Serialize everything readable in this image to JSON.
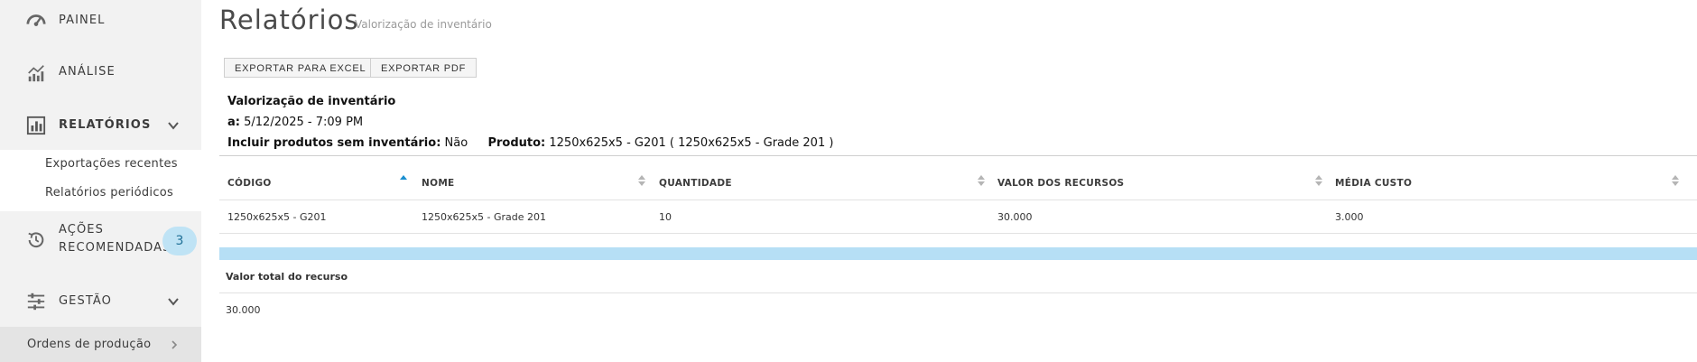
{
  "sidebar": {
    "items": [
      {
        "label": "PAINEL",
        "icon": "gauge-icon"
      },
      {
        "label": "ANÁLISE",
        "icon": "analytics-icon"
      },
      {
        "label": "RELATÓRIOS",
        "icon": "reports-icon"
      },
      {
        "label": "AÇÕES",
        "label2": "RECOMENDADAS",
        "icon": "history-icon",
        "badge": "3"
      },
      {
        "label": "GESTÃO",
        "icon": "sliders-icon"
      }
    ],
    "subitems": [
      "Exportações recentes",
      "Relatórios periódicos"
    ],
    "bottom": {
      "label": "Ordens de produção"
    }
  },
  "header": {
    "title": "Relatórios",
    "subtitle": "Valorização de inventário"
  },
  "toolbar": {
    "excel_label": "EXPORTAR PARA EXCEL",
    "pdf_label": "EXPORTAR PDF"
  },
  "report": {
    "title": "Valorização de inventário",
    "date_label": "a:",
    "date_value": "5/12/2025 - 7:09 PM",
    "include_label": "Incluir produtos sem inventário:",
    "include_value": "Não",
    "product_label": "Produto:",
    "product_value": "1250x625x5 - G201 ( 1250x625x5 - Grade 201 )"
  },
  "table": {
    "columns": [
      "CÓDIGO",
      "NOME",
      "QUANTIDADE",
      "VALOR DOS RECURSOS",
      "MÉDIA CUSTO"
    ],
    "rows": [
      [
        "1250x625x5 - G201",
        "1250x625x5 - Grade 201",
        "10",
        "30.000",
        "3.000"
      ]
    ],
    "total_label": "Valor total do recurso",
    "total_value": "30.000"
  },
  "colors": {
    "accent": "#1a8fd0",
    "badge_bg": "#bfe3f5",
    "summary_bar": "#b6dff5",
    "sidebar_bg": "#f2f2f2"
  }
}
